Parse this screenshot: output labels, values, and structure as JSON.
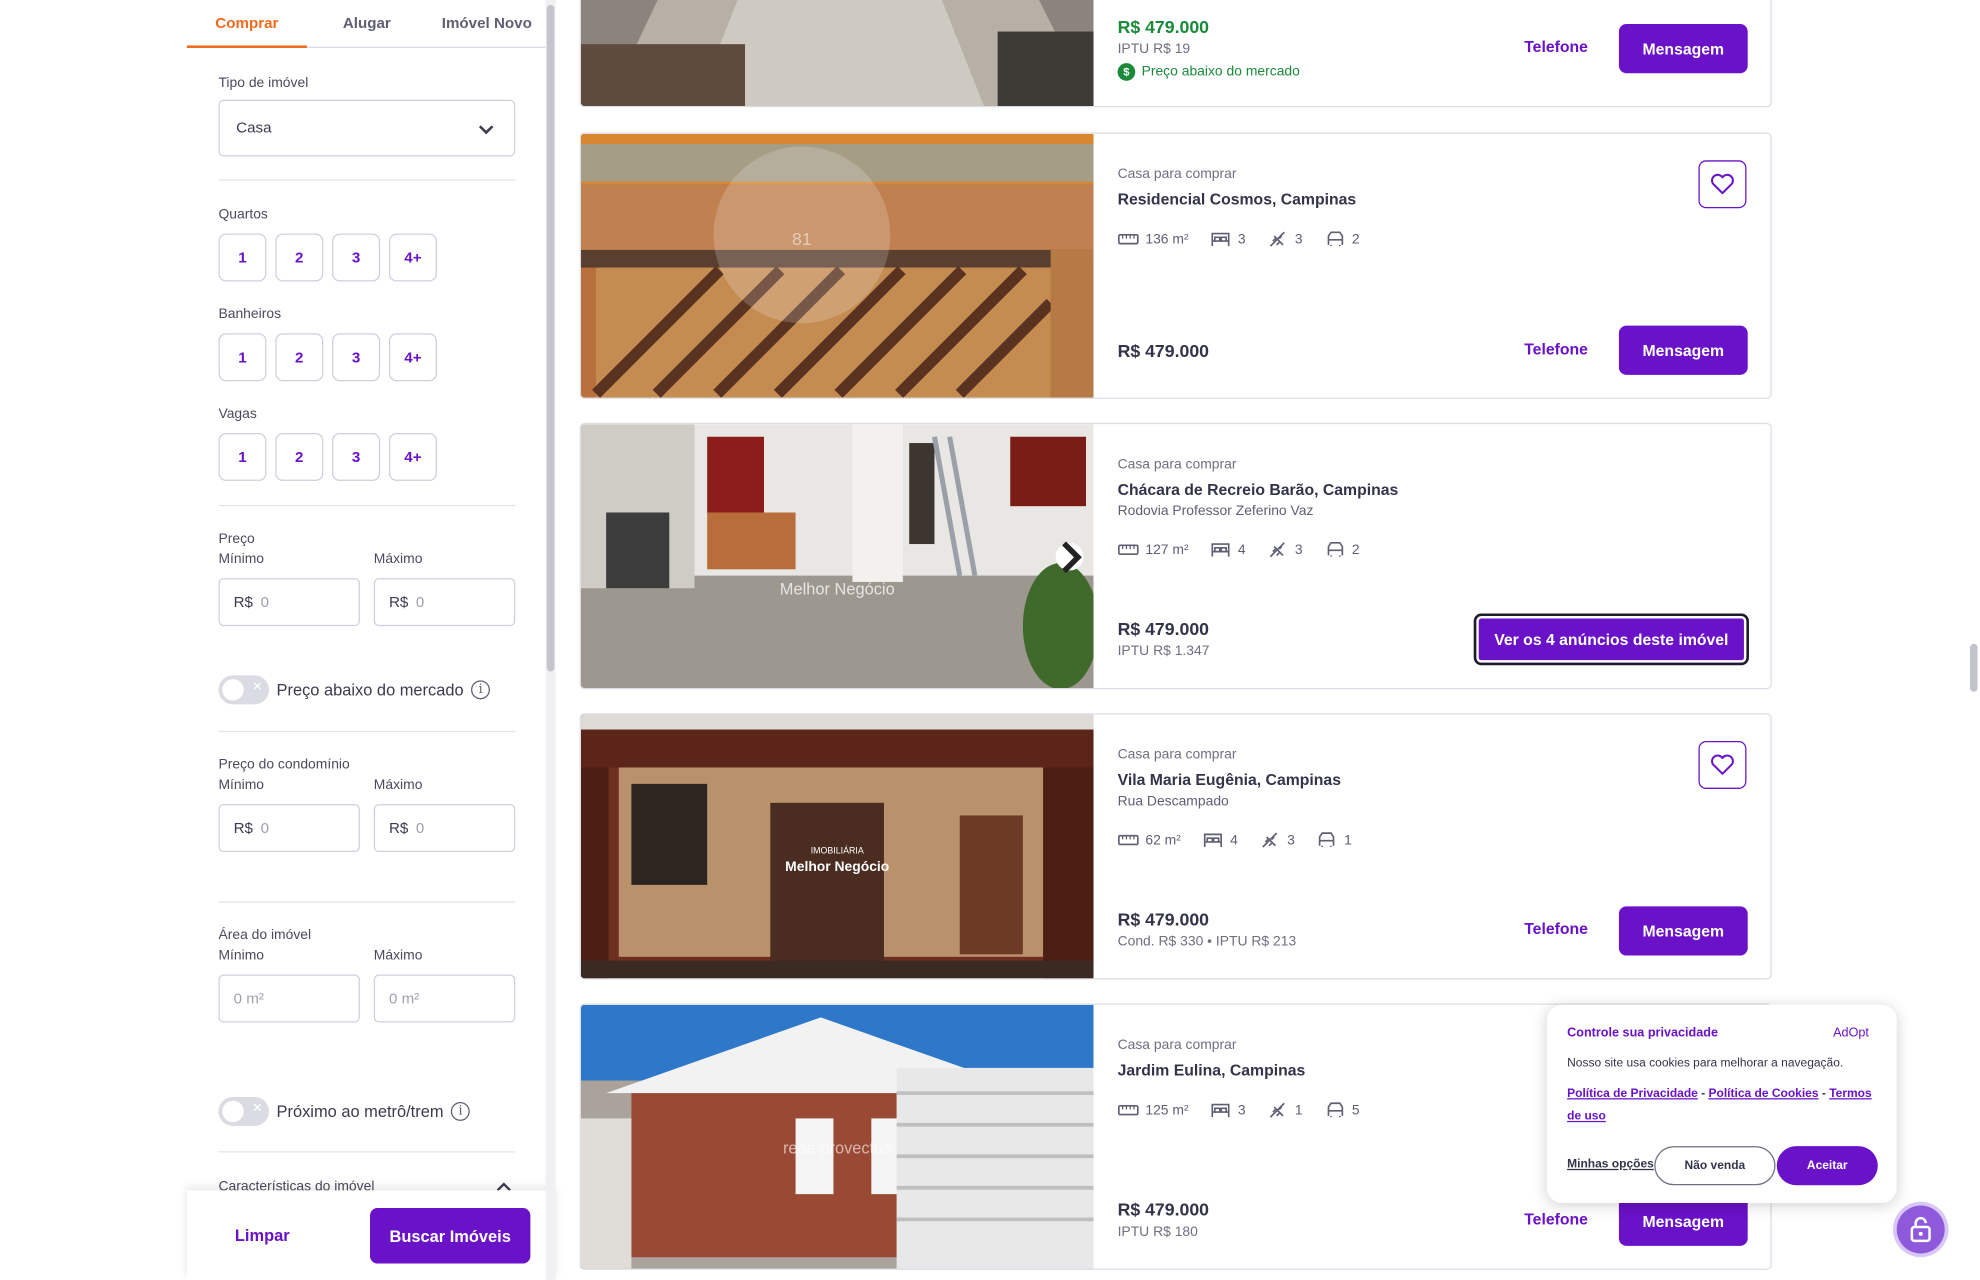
{
  "tabs": [
    "Comprar",
    "Alugar",
    "Imóvel Novo"
  ],
  "filters": {
    "property_type": {
      "label": "Tipo de imóvel",
      "value": "Casa"
    },
    "bedrooms": {
      "label": "Quartos",
      "options": [
        "1",
        "2",
        "3",
        "4+"
      ]
    },
    "bathrooms": {
      "label": "Banheiros",
      "options": [
        "1",
        "2",
        "3",
        "4+"
      ]
    },
    "parking": {
      "label": "Vagas",
      "options": [
        "1",
        "2",
        "3",
        "4+"
      ]
    },
    "price": {
      "label": "Preço",
      "min_label": "Mínimo",
      "max_label": "Máximo",
      "currency": "R$",
      "min_placeholder": "0",
      "max_placeholder": "0"
    },
    "below_market": {
      "label": "Preço abaixo do mercado",
      "enabled": false
    },
    "condo_price": {
      "label": "Preço do condomínio",
      "min_label": "Mínimo",
      "max_label": "Máximo",
      "currency": "R$",
      "min_placeholder": "0",
      "max_placeholder": "0"
    },
    "area": {
      "label": "Área do imóvel",
      "min_label": "Mínimo",
      "max_label": "Máximo",
      "min_placeholder": "0 m²",
      "max_placeholder": "0 m²"
    },
    "near_transit": {
      "label": "Próximo ao metrô/trem",
      "enabled": false
    },
    "features_section": {
      "label": "Características do imóvel"
    },
    "clear_label": "Limpar",
    "search_label": "Buscar Imóveis"
  },
  "listings": [
    {
      "price": "R$ 479.000",
      "iptu": "IPTU R$ 19",
      "tag": "Preço abaixo do mercado",
      "phone_label": "Telefone",
      "message_label": "Mensagem"
    },
    {
      "type": "Casa para comprar",
      "location": "Residencial Cosmos, Campinas",
      "area": "136 m²",
      "bedrooms": "3",
      "bathrooms": "3",
      "parking": "2",
      "price": "R$ 479.000",
      "phone_label": "Telefone",
      "message_label": "Mensagem",
      "watermark": "81"
    },
    {
      "type": "Casa para comprar",
      "location": "Chácara de Recreio Barão, Campinas",
      "street": "Rodovia Professor Zeferino Vaz",
      "area": "127 m²",
      "bedrooms": "4",
      "bathrooms": "3",
      "parking": "2",
      "price": "R$ 479.000",
      "iptu": "IPTU R$ 1.347",
      "ads_label": "Ver os 4 anúncios deste imóvel",
      "watermark": "Melhor Negócio"
    },
    {
      "type": "Casa para comprar",
      "location": "Vila Maria Eugênia, Campinas",
      "street": "Rua Descampado",
      "area": "62 m²",
      "bedrooms": "4",
      "bathrooms": "3",
      "parking": "1",
      "price": "R$ 479.000",
      "fees": "Cond. R$ 330 • IPTU R$ 213",
      "phone_label": "Telefone",
      "message_label": "Mensagem",
      "watermark_small": "IMOBILIÁRIA",
      "watermark": "Melhor Negócio"
    },
    {
      "type": "Casa para comprar",
      "location": "Jardim Eulina, Campinas",
      "area": "125 m²",
      "bedrooms": "3",
      "bathrooms": "1",
      "parking": "5",
      "price": "R$ 479.000",
      "iptu": "IPTU R$ 180",
      "phone_label": "Telefone",
      "message_label": "Mensagem",
      "watermark": "rede provectus"
    }
  ],
  "cookie_banner": {
    "title": "Controle sua privacidade",
    "brand": "AdOpt",
    "text": "Nosso site usa cookies para melhorar a navegação.",
    "privacy_link": "Política de Privacidade",
    "cookies_link": "Política de Cookies",
    "terms_link": "Termos de uso",
    "separator": "-",
    "options_label": "Minhas opções",
    "decline_label": "Não venda",
    "accept_label": "Aceitar"
  },
  "colors": {
    "brand_purple": "#6a12c8",
    "active_tab_orange": "#f06b1f",
    "green_tag": "#1a8a3a"
  }
}
